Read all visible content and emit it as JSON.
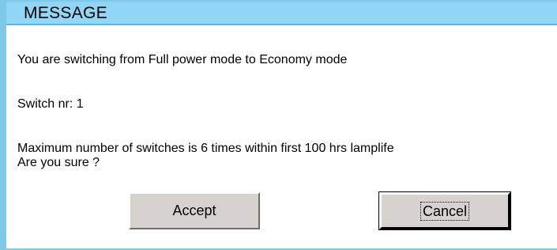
{
  "dialog": {
    "title": "MESSAGE",
    "lines": [
      "You are switching from Full power mode to Economy mode",
      "Switch nr: 1",
      "Maximum number of switches is 6 times within first 100 hrs   lamplife",
      "Are you sure ?"
    ],
    "accept_label": "Accept",
    "cancel_label": "Cancel"
  },
  "colors": {
    "title_bar": "#92d6f5",
    "frame": "#7ec8e8",
    "button_face": "#d6d3ce"
  }
}
